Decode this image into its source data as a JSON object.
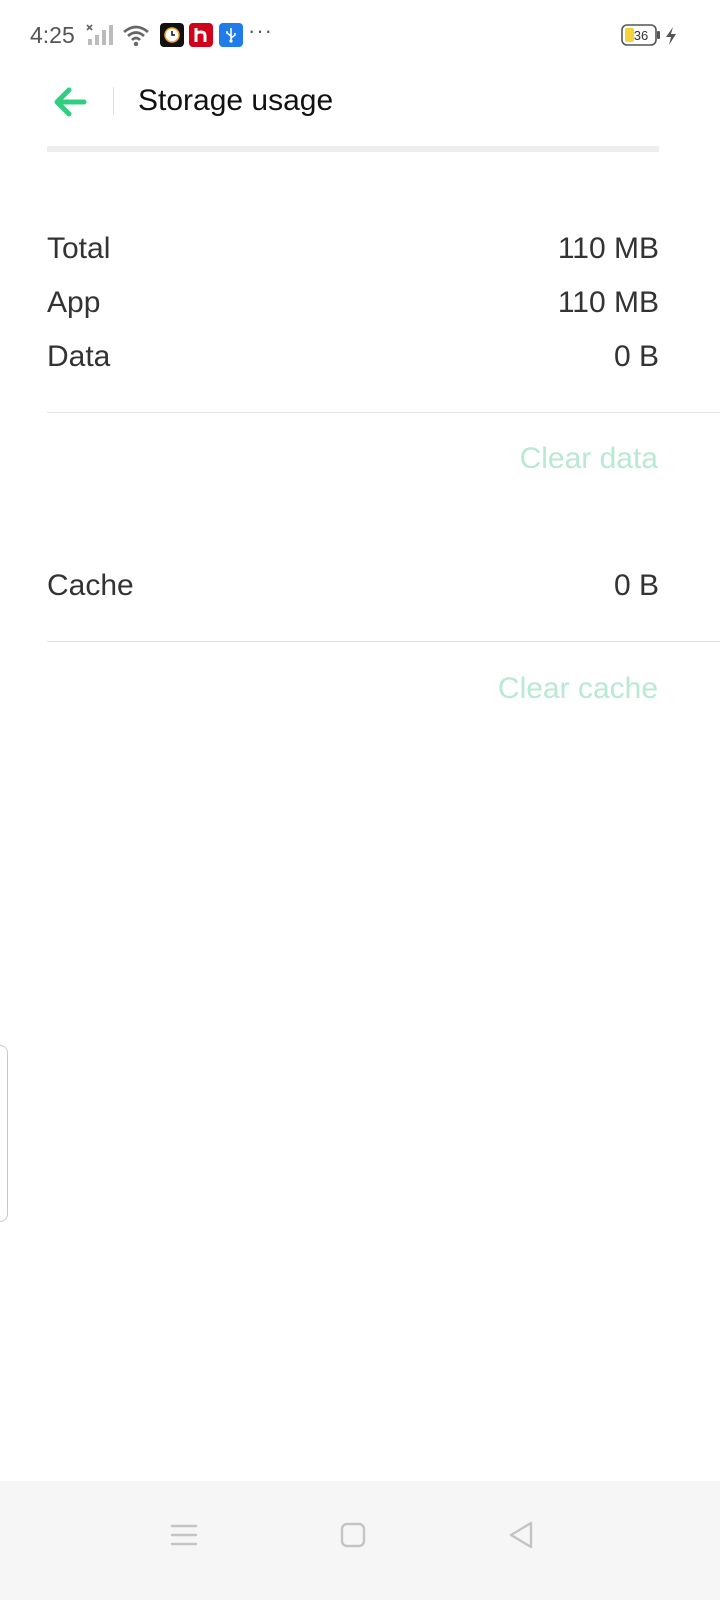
{
  "status_bar": {
    "time": "4:25",
    "battery_level": "36",
    "icons": [
      "signal-icon",
      "wifi-icon",
      "clock-app-icon",
      "h-app-icon",
      "usb-icon",
      "more-icon",
      "battery-icon",
      "charging-icon"
    ],
    "more": "···"
  },
  "header": {
    "title": "Storage usage",
    "back_icon": "arrow-left-icon"
  },
  "storage": {
    "rows": [
      {
        "label": "Total",
        "value": "110 MB"
      },
      {
        "label": "App",
        "value": "110 MB"
      },
      {
        "label": "Data",
        "value": "0 B"
      }
    ],
    "clear_data_label": "Clear data"
  },
  "cache": {
    "label": "Cache",
    "value": "0 B",
    "clear_cache_label": "Clear cache"
  },
  "nav_bar": {
    "icons": [
      "menu-icon",
      "home-icon",
      "back-icon"
    ]
  },
  "colors": {
    "accent": "#2fcf7f",
    "action_disabled": "#b8e9d2",
    "nav_background": "#f6f6f6"
  }
}
